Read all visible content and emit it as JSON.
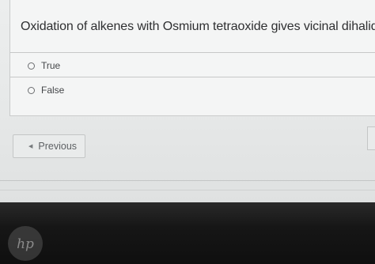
{
  "question": {
    "text": "Oxidation of alkenes with Osmium tetraoxide gives vicinal dihalide."
  },
  "options": [
    {
      "label": "True",
      "selected": false
    },
    {
      "label": "False",
      "selected": false
    }
  ],
  "navigation": {
    "previous_label": "Previous",
    "previous_icon": "caret-left-icon"
  },
  "device": {
    "logo_text": "hp"
  },
  "colors": {
    "screen_bg": "#eceeee",
    "card_bg": "#f4f5f5",
    "text": "#2e2f31",
    "bezel": "#161616"
  }
}
